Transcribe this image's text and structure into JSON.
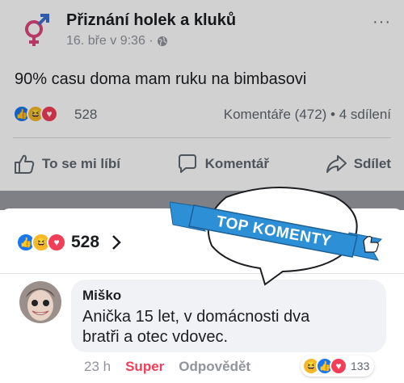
{
  "post": {
    "page_name": "Přiznání holek a kluků",
    "timestamp": "16. bře v 9:36 ·",
    "more_label": "···",
    "text": "90% casu doma mam ruku na bimbasovi",
    "reaction_count": "528",
    "comments_shares": "Komentáře (472) • 4 sdílení",
    "actions": {
      "like": "To se mi líbí",
      "comment": "Komentář",
      "share": "Sdílet"
    }
  },
  "sheet": {
    "reaction_count": "528",
    "badge_text": "TOP KOMENTY"
  },
  "comment": {
    "author": "Miško",
    "text": "Anička 15 let, v domácnosti dva bratři a otec vdovec.",
    "time": "23 h",
    "super_label": "Super",
    "reply_label": "Odpovědět",
    "reaction_count": "133"
  },
  "icons": {
    "logo": "gender-symbols-icon",
    "globe": "globe-icon",
    "like": "thumbs-up-icon",
    "comment": "speech-bubble-icon",
    "share": "share-arrow-icon",
    "chevron": "chevron-right-icon"
  },
  "colors": {
    "facebook_blue": "#1877f2",
    "love_red": "#f33e58",
    "haha_yellow": "#f7b928",
    "badge_blue": "#2d8fd5"
  }
}
